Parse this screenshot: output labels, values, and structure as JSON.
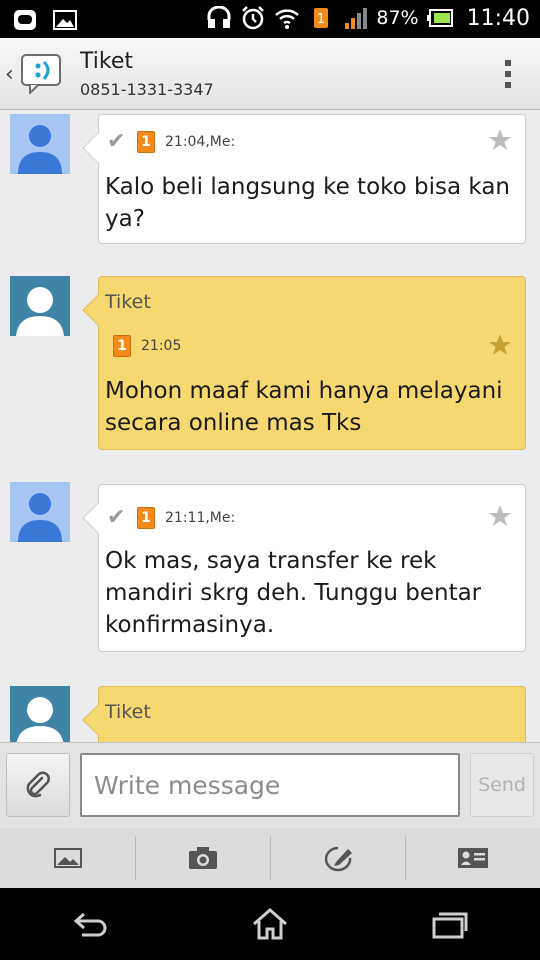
{
  "status_bar": {
    "icons": [
      "line-app-icon",
      "image-notification-icon",
      "headset-icon",
      "alarm-icon",
      "wifi-icon",
      "sim-icon",
      "signal-icon",
      "battery-icon"
    ],
    "battery_percent": "87%",
    "time": "11:40"
  },
  "header": {
    "title": "Tiket",
    "subtitle": "0851-1331-3347"
  },
  "messages": [
    {
      "direction": "outgoing",
      "sender": "",
      "sim": "1",
      "meta": "21:04,Me:",
      "text": "Kalo beli langsung ke toko bisa kan ya?",
      "starred": false
    },
    {
      "direction": "incoming",
      "sender": "Tiket",
      "sim": "1",
      "meta": "21:05",
      "text": "Mohon maaf  kami hanya melayani secara online mas Tks",
      "starred": true
    },
    {
      "direction": "outgoing",
      "sender": "",
      "sim": "1",
      "meta": "21:11,Me:",
      "text": "Ok mas, saya transfer ke rek mandiri skrg deh. Tunggu bentar konfirmasinya.",
      "starred": false
    },
    {
      "direction": "incoming",
      "sender": "Tiket",
      "sim": "",
      "meta": "",
      "text": "",
      "starred": false
    }
  ],
  "compose": {
    "placeholder": "Write message",
    "value": "",
    "send_label": "Send"
  },
  "attach_toolbar": [
    "gallery-icon",
    "camera-icon",
    "sketch-icon",
    "contact-card-icon"
  ],
  "nav_bar": [
    "back-icon",
    "home-icon",
    "recents-icon"
  ],
  "colors": {
    "incoming_bubble": "#f6d770",
    "outgoing_bubble": "#ffffff",
    "sim_badge": "#f28a1c"
  }
}
